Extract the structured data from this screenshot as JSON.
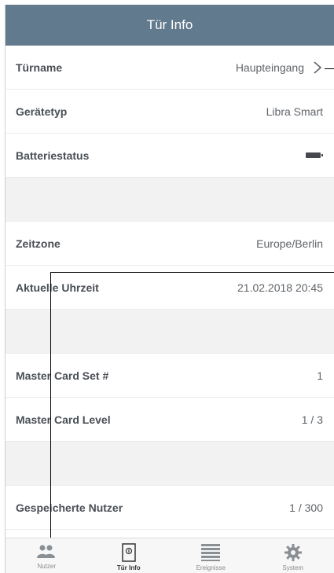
{
  "header": {
    "title": "Tür Info"
  },
  "rows": [
    {
      "label": "Türname",
      "value": "Haupteingang"
    },
    {
      "label": "Gerätetyp",
      "value": "Libra Smart"
    },
    {
      "label": "Batteriestatus",
      "value": ""
    },
    {
      "label": "Zeitzone",
      "value": "Europe/Berlin"
    },
    {
      "label": "Aktuelle Uhrzeit",
      "value": "21.02.2018 20:45"
    },
    {
      "label": "Master Card Set #",
      "value": "1"
    },
    {
      "label": "Master Card Level",
      "value": "1 / 3"
    },
    {
      "label": "Gespeicherte Nutzer",
      "value": "1 / 300"
    }
  ],
  "battery": {
    "level": 1.0
  },
  "tabs": [
    {
      "label": "Nutzer",
      "icon": "users-icon"
    },
    {
      "label": "Tür Info",
      "icon": "door-icon"
    },
    {
      "label": "Ereignisse",
      "icon": "list-icon"
    },
    {
      "label": "System",
      "icon": "gear-icon"
    }
  ],
  "colors": {
    "header": "#627a8e",
    "spacer": "#f2f2f2"
  }
}
